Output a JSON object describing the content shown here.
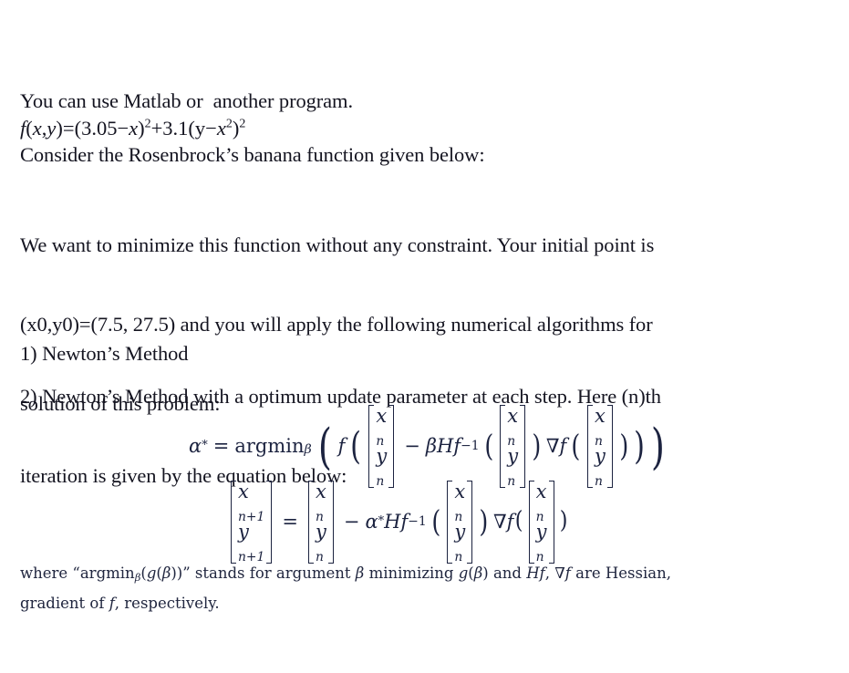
{
  "document": {
    "background_color": "#ffffff",
    "text_color": "#141420",
    "math_color": "#1c2340"
  },
  "body": {
    "intro": "You can use Matlab or  another program.",
    "consider_line": "Consider the Rosenbrock’s banana function given below:",
    "function_definition": {
      "lhs": "f(x,y)=",
      "term1_open": "(3.05−x)",
      "term1_exp": "2",
      "plus": "+3.1(y−x",
      "inner_exp": "2",
      "close": ")",
      "outer_exp": "2",
      "plain_text": "f(x,y)=(3.05−x)²+3.1(y−x²)²"
    },
    "minimize_paragraph": [
      "We want to minimize this function without any constraint. Your initial point is",
      "(x0,y0)=(7.5, 27.5) and you will apply the following numerical algorithms for",
      "solution of this problem:"
    ],
    "initial_point": {
      "x0": "7.5",
      "y0": "27.5",
      "label": "(x0,y0)=(7.5, 27.5)"
    },
    "methods": [
      {
        "number": "1)",
        "text": "Newton’s Method",
        "full": "1) Newton’s Method"
      },
      {
        "number": "2)",
        "text": "Newton’s Method with a optimum update parameter at each step. Here (n)th iteration is given by the equation below:",
        "lines": [
          "2) Newton’s Method with a optimum update parameter at each step. Here (n)th",
          "iteration is given by the equation below:"
        ]
      }
    ]
  },
  "equations": {
    "argmin": {
      "alpha": "α",
      "star": "*",
      "equals": "=",
      "argmin": "argmin",
      "beta_sub": "β",
      "f": "f",
      "minus": "−",
      "beta": "β",
      "H": "H",
      "Hf": "Hf",
      "inverse": "−1",
      "nabla_f": "∇f",
      "vector_top": "x",
      "vector_bottom": "y",
      "vector_sub": "n",
      "plain_text": "α* = argminβ ( f([xn;yn] − βHf⁻¹([xn;yn]) ∇f([xn;yn])) )"
    },
    "iteration": {
      "equals": "=",
      "minus": "−",
      "alpha": "α",
      "star": "*",
      "Hf": "Hf",
      "inverse": "−1",
      "nabla_f": "∇f",
      "lhs_top": "x",
      "lhs_bottom": "y",
      "lhs_sub": "n+1",
      "rhs_top": "x",
      "rhs_bottom": "y",
      "rhs_sub": "n",
      "plain_text": "[xn+1;yn+1] = [xn;yn] − α*Hf⁻¹([xn;yn]) ∇f([xn;yn])"
    }
  },
  "note": {
    "line1": {
      "prefix": "where “argmin",
      "beta_sub": "β",
      "mid": "(",
      "g": "g",
      "open": "(",
      "beta": "β",
      "close": "))”",
      "stands": "stands for argument",
      "beta2": "β",
      "minimizing": "minimizing",
      "g2": "g",
      "beta3": "β",
      "and": "and",
      "Hf": "Hf",
      "comma": ",",
      "nabla_f": "∇f",
      "tail": "are Hessian,",
      "plain_text": "where “argminβ(g(β))” stands for argument β minimizing g(β) and Hf, ∇f are Hessian,"
    },
    "line2": {
      "prefix": "gradient of",
      "f": "f",
      "tail": ", respectively.",
      "plain_text": "gradient of f, respectively."
    }
  }
}
